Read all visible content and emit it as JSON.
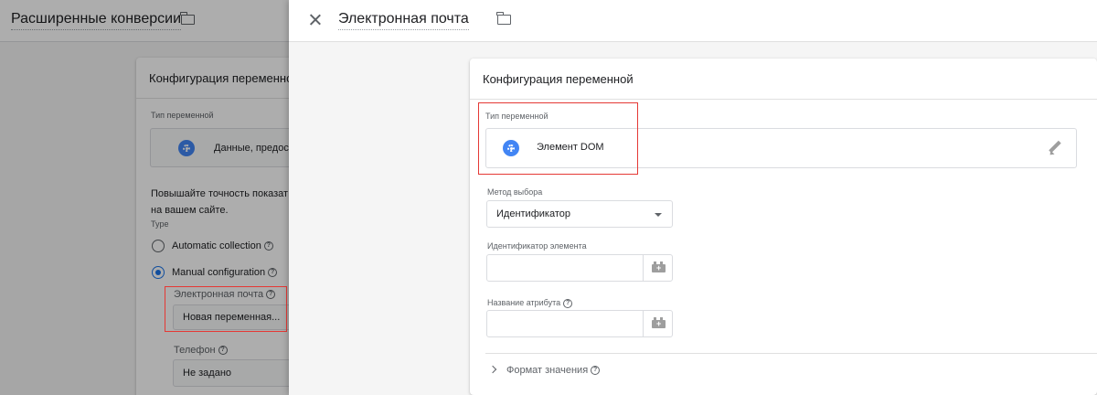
{
  "background": {
    "title": "Расширенные конверсии",
    "card_title": "Конфигурация переменной",
    "var_type_label": "Тип переменной",
    "var_type_value": "Данные, предостав",
    "description_line1": "Повышайте точность показат",
    "description_line2": "на вашем сайте.",
    "type_label": "Type",
    "option_auto": "Automatic collection",
    "option_manual": "Manual configuration",
    "email_label": "Электронная почта",
    "email_value": "Новая переменная...",
    "phone_label": "Телефон",
    "phone_value": "Не задано"
  },
  "panel": {
    "title": "Электронная почта",
    "card_title": "Конфигурация переменной",
    "var_type_label": "Тип переменной",
    "var_type_value": "Элемент DOM",
    "method_label": "Метод выбора",
    "method_value": "Идентификатор",
    "element_id_label": "Идентификатор элемента",
    "element_id_value": "",
    "attribute_label": "Название атрибута",
    "attribute_value": "",
    "format_label": "Формат значения",
    "help_glyph": "?"
  },
  "colors": {
    "accent": "#1a73e8",
    "gear_badge": "#4285f4",
    "annotation_red": "#e53935"
  }
}
